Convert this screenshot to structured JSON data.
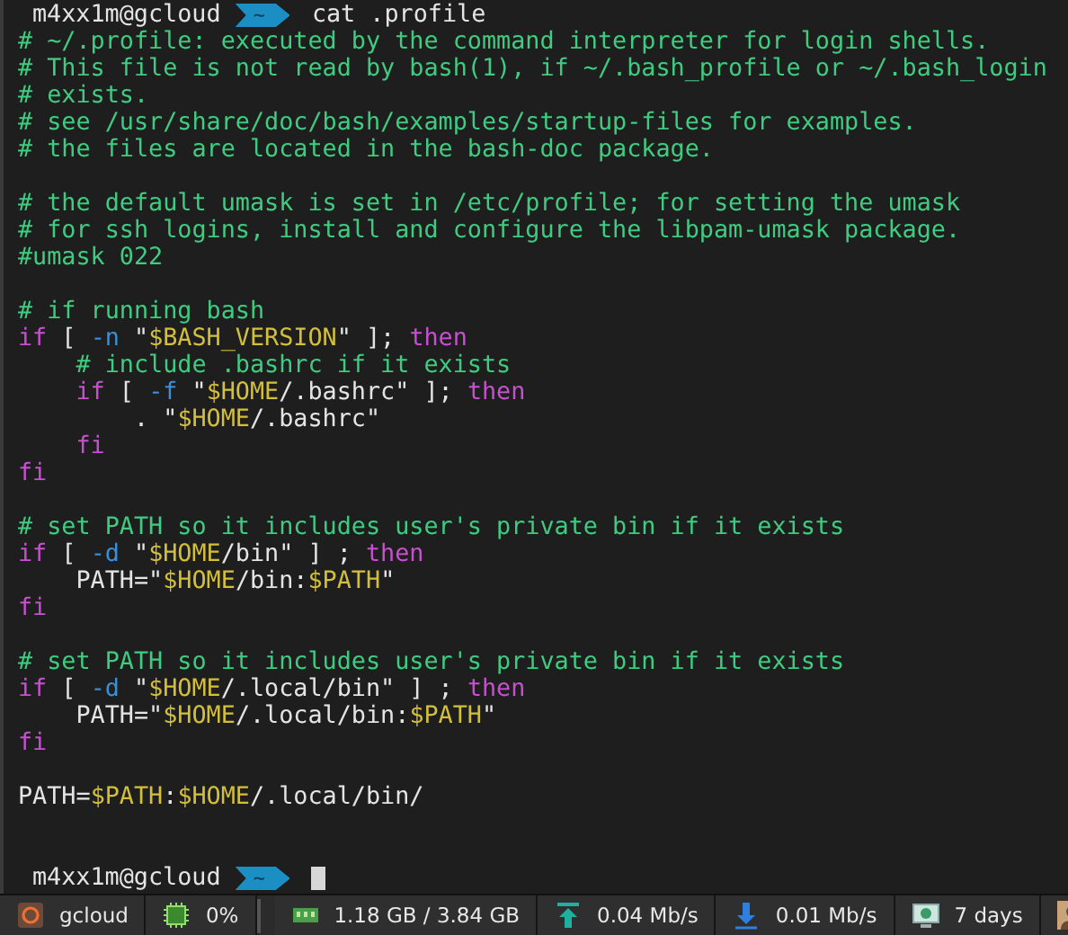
{
  "prompts": [
    {
      "user": "m4xx1m@gcloud",
      "dir": "~",
      "command": "cat .profile",
      "cursor": false
    },
    {
      "user": "m4xx1m@gcloud",
      "dir": "~",
      "cursor": true
    }
  ],
  "output": [
    {
      "kind": "code",
      "segments": [
        {
          "kind": "comment",
          "text": "# ~/.profile: executed by the command interpreter for login shells."
        }
      ]
    },
    {
      "kind": "code",
      "segments": [
        {
          "kind": "comment",
          "text": "# This file is not read by bash(1), if ~/.bash_profile or ~/.bash_login"
        }
      ]
    },
    {
      "kind": "code",
      "segments": [
        {
          "kind": "comment",
          "text": "# exists."
        }
      ]
    },
    {
      "kind": "code",
      "segments": [
        {
          "kind": "comment",
          "text": "# see /usr/share/doc/bash/examples/startup-files for examples."
        }
      ]
    },
    {
      "kind": "code",
      "segments": [
        {
          "kind": "comment",
          "text": "# the files are located in the bash-doc package."
        }
      ]
    },
    {
      "kind": "blank"
    },
    {
      "kind": "code",
      "segments": [
        {
          "kind": "comment",
          "text": "# the default umask is set in /etc/profile; for setting the umask"
        }
      ]
    },
    {
      "kind": "code",
      "segments": [
        {
          "kind": "comment",
          "text": "# for ssh logins, install and configure the libpam-umask package."
        }
      ]
    },
    {
      "kind": "code",
      "segments": [
        {
          "kind": "comment",
          "text": "#umask 022"
        }
      ]
    },
    {
      "kind": "blank"
    },
    {
      "kind": "code",
      "segments": [
        {
          "kind": "comment",
          "text": "# if running bash"
        }
      ]
    },
    {
      "kind": "code",
      "segments": [
        {
          "kind": "keyword",
          "text": "if"
        },
        {
          "kind": "plain",
          "text": " [ "
        },
        {
          "kind": "flag",
          "text": "-n"
        },
        {
          "kind": "plain",
          "text": " \""
        },
        {
          "kind": "var",
          "text": "$BASH_VERSION"
        },
        {
          "kind": "plain",
          "text": "\" ]; "
        },
        {
          "kind": "keyword",
          "text": "then"
        }
      ]
    },
    {
      "kind": "code",
      "segments": [
        {
          "kind": "comment",
          "text": "    # include .bashrc if it exists"
        }
      ]
    },
    {
      "kind": "code",
      "segments": [
        {
          "kind": "keyword",
          "text": "    if"
        },
        {
          "kind": "plain",
          "text": " [ "
        },
        {
          "kind": "flag",
          "text": "-f"
        },
        {
          "kind": "plain",
          "text": " \""
        },
        {
          "kind": "var",
          "text": "$HOME"
        },
        {
          "kind": "plain",
          "text": "/.bashrc\" ]; "
        },
        {
          "kind": "keyword",
          "text": "then"
        }
      ]
    },
    {
      "kind": "code",
      "segments": [
        {
          "kind": "plain",
          "text": "        . \""
        },
        {
          "kind": "var",
          "text": "$HOME"
        },
        {
          "kind": "plain",
          "text": "/.bashrc\""
        }
      ]
    },
    {
      "kind": "code",
      "segments": [
        {
          "kind": "keyword",
          "text": "    fi"
        }
      ]
    },
    {
      "kind": "code",
      "segments": [
        {
          "kind": "keyword",
          "text": "fi"
        }
      ]
    },
    {
      "kind": "blank"
    },
    {
      "kind": "code",
      "segments": [
        {
          "kind": "comment",
          "text": "# set PATH so it includes user's private bin if it exists"
        }
      ]
    },
    {
      "kind": "code",
      "segments": [
        {
          "kind": "keyword",
          "text": "if"
        },
        {
          "kind": "plain",
          "text": " [ "
        },
        {
          "kind": "flag",
          "text": "-d"
        },
        {
          "kind": "plain",
          "text": " \""
        },
        {
          "kind": "var",
          "text": "$HOME"
        },
        {
          "kind": "plain",
          "text": "/bin\" ] ; "
        },
        {
          "kind": "keyword",
          "text": "then"
        }
      ]
    },
    {
      "kind": "code",
      "segments": [
        {
          "kind": "plain",
          "text": "    PATH=\""
        },
        {
          "kind": "var",
          "text": "$HOME"
        },
        {
          "kind": "plain",
          "text": "/bin:"
        },
        {
          "kind": "var",
          "text": "$PATH"
        },
        {
          "kind": "plain",
          "text": "\""
        }
      ]
    },
    {
      "kind": "code",
      "segments": [
        {
          "kind": "keyword",
          "text": "fi"
        }
      ]
    },
    {
      "kind": "blank"
    },
    {
      "kind": "code",
      "segments": [
        {
          "kind": "comment",
          "text": "# set PATH so it includes user's private bin if it exists"
        }
      ]
    },
    {
      "kind": "code",
      "segments": [
        {
          "kind": "keyword",
          "text": "if"
        },
        {
          "kind": "plain",
          "text": " [ "
        },
        {
          "kind": "flag",
          "text": "-d"
        },
        {
          "kind": "plain",
          "text": " \""
        },
        {
          "kind": "var",
          "text": "$HOME"
        },
        {
          "kind": "plain",
          "text": "/.local/bin\" ] ; "
        },
        {
          "kind": "keyword",
          "text": "then"
        }
      ]
    },
    {
      "kind": "code",
      "segments": [
        {
          "kind": "plain",
          "text": "    PATH=\""
        },
        {
          "kind": "var",
          "text": "$HOME"
        },
        {
          "kind": "plain",
          "text": "/.local/bin:"
        },
        {
          "kind": "var",
          "text": "$PATH"
        },
        {
          "kind": "plain",
          "text": "\""
        }
      ]
    },
    {
      "kind": "code",
      "segments": [
        {
          "kind": "keyword",
          "text": "fi"
        }
      ]
    },
    {
      "kind": "blank"
    },
    {
      "kind": "code",
      "segments": [
        {
          "kind": "plain",
          "text": "PATH="
        },
        {
          "kind": "var",
          "text": "$PATH"
        },
        {
          "kind": "plain",
          "text": ":"
        },
        {
          "kind": "var",
          "text": "$HOME"
        },
        {
          "kind": "plain",
          "text": "/.local/bin/"
        }
      ]
    },
    {
      "kind": "blank"
    },
    {
      "kind": "blank"
    }
  ],
  "status_bar": [
    {
      "kind": "host",
      "label": "gcloud"
    },
    {
      "kind": "cpu",
      "label": "0%"
    },
    {
      "kind": "graph"
    },
    {
      "kind": "memory",
      "label": "1.18 GB / 3.84 GB"
    },
    {
      "kind": "upload",
      "label": "0.04 Mb/s"
    },
    {
      "kind": "download",
      "label": "0.01 Mb/s"
    },
    {
      "kind": "uptime",
      "label": "7 days"
    },
    {
      "kind": "user"
    }
  ]
}
